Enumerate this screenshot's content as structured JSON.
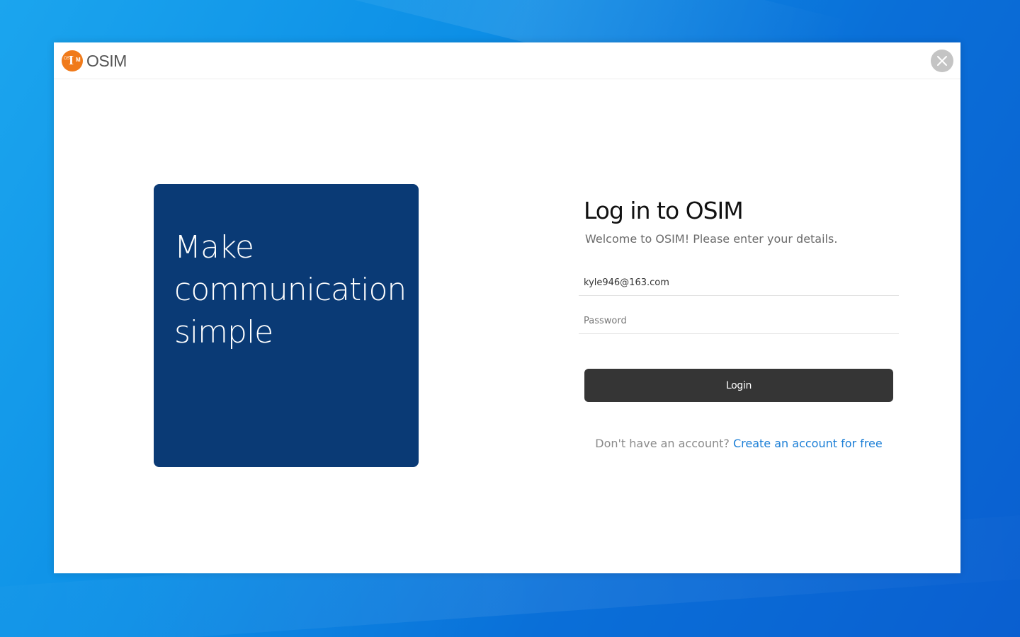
{
  "app": {
    "name": "OSIM",
    "logo_mark": {
      "os": "OS",
      "i": "I",
      "m": "M"
    }
  },
  "titlebar": {
    "close_icon": "close-icon"
  },
  "hero": {
    "line1": "Make",
    "line2": "communication",
    "line3": "simple",
    "background_color": "#0a3a75"
  },
  "login_form": {
    "title": "Log in to OSIM",
    "subtitle": "Welcome to OSIM! Please enter your details.",
    "email": {
      "value": "kyle946@163.com",
      "placeholder": ""
    },
    "password": {
      "value": "",
      "placeholder": "Password"
    },
    "login_button": "Login",
    "signup_prompt": "Don't have an account?",
    "signup_link": "Create an account for free"
  },
  "colors": {
    "accent_link": "#1a7ed6",
    "button_bg": "#353535",
    "logo_orange": "#f07a1a"
  }
}
